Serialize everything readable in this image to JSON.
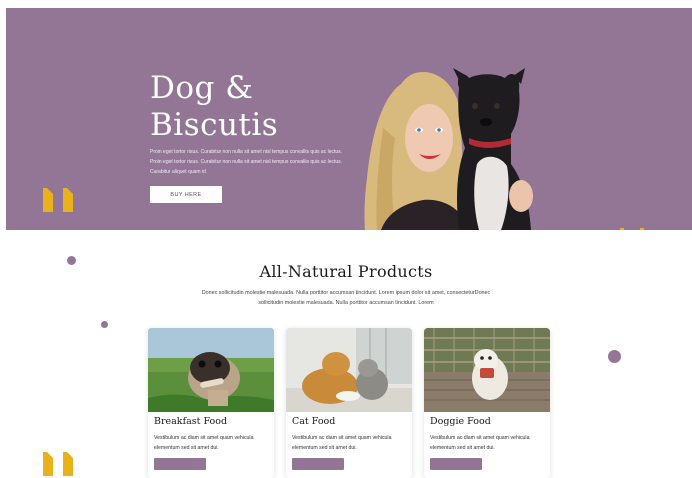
{
  "theme": {
    "accent": "#937696",
    "quote_yellow": "#e9b21a"
  },
  "hero": {
    "title_line1": "Dog &",
    "title_line2": "Biscutis",
    "description": "Proin eget tortor risus. Curabitur non nulla sit amet nisl tempus convallis quis ac lectus. Proin eget tortor risus. Curabitur non nulla sit amet nisl tempus convallis quis ac lectus. Curabitur aliquet quam id",
    "button_label": "BUY HERE"
  },
  "products": {
    "title": "All-Natural Products",
    "description": "Donec sollicitudin molestie malesuada. Nulla porttitor accumsan tincidunt. Lorem ipsum dolor sit amet, consecteturDonec sollicitudin molestie malesuada. Nulla porttitor accumsan tincidunt. Lorem",
    "cards": [
      {
        "title": "Breakfast Food",
        "text": "Vestibulum ac diam sit amet quam vehicula elementum sed sit amet dui."
      },
      {
        "title": "Cat Food",
        "text": "Vestibulum ac diam sit amet quam vehicula elementum sed sit amet dui."
      },
      {
        "title": "Doggie Food",
        "text": "Vestibulum ac diam sit amet quam vehicula elementum sed sit amet dui."
      }
    ]
  }
}
